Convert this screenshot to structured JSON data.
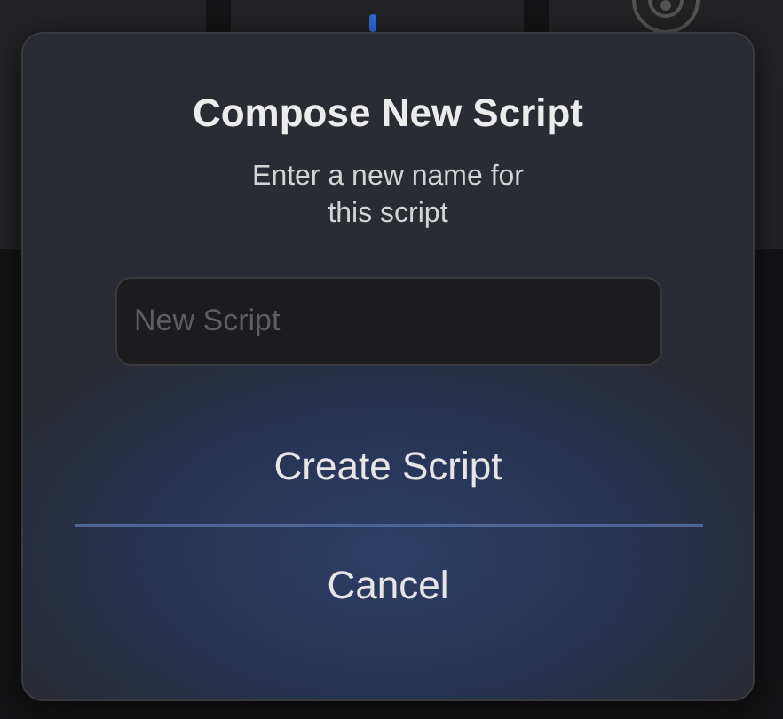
{
  "dialog": {
    "title": "Compose New Script",
    "message": "Enter a new name for this script",
    "name_field": {
      "placeholder": "New Script"
    },
    "buttons": [
      "Create Script",
      "Cancel"
    ]
  }
}
